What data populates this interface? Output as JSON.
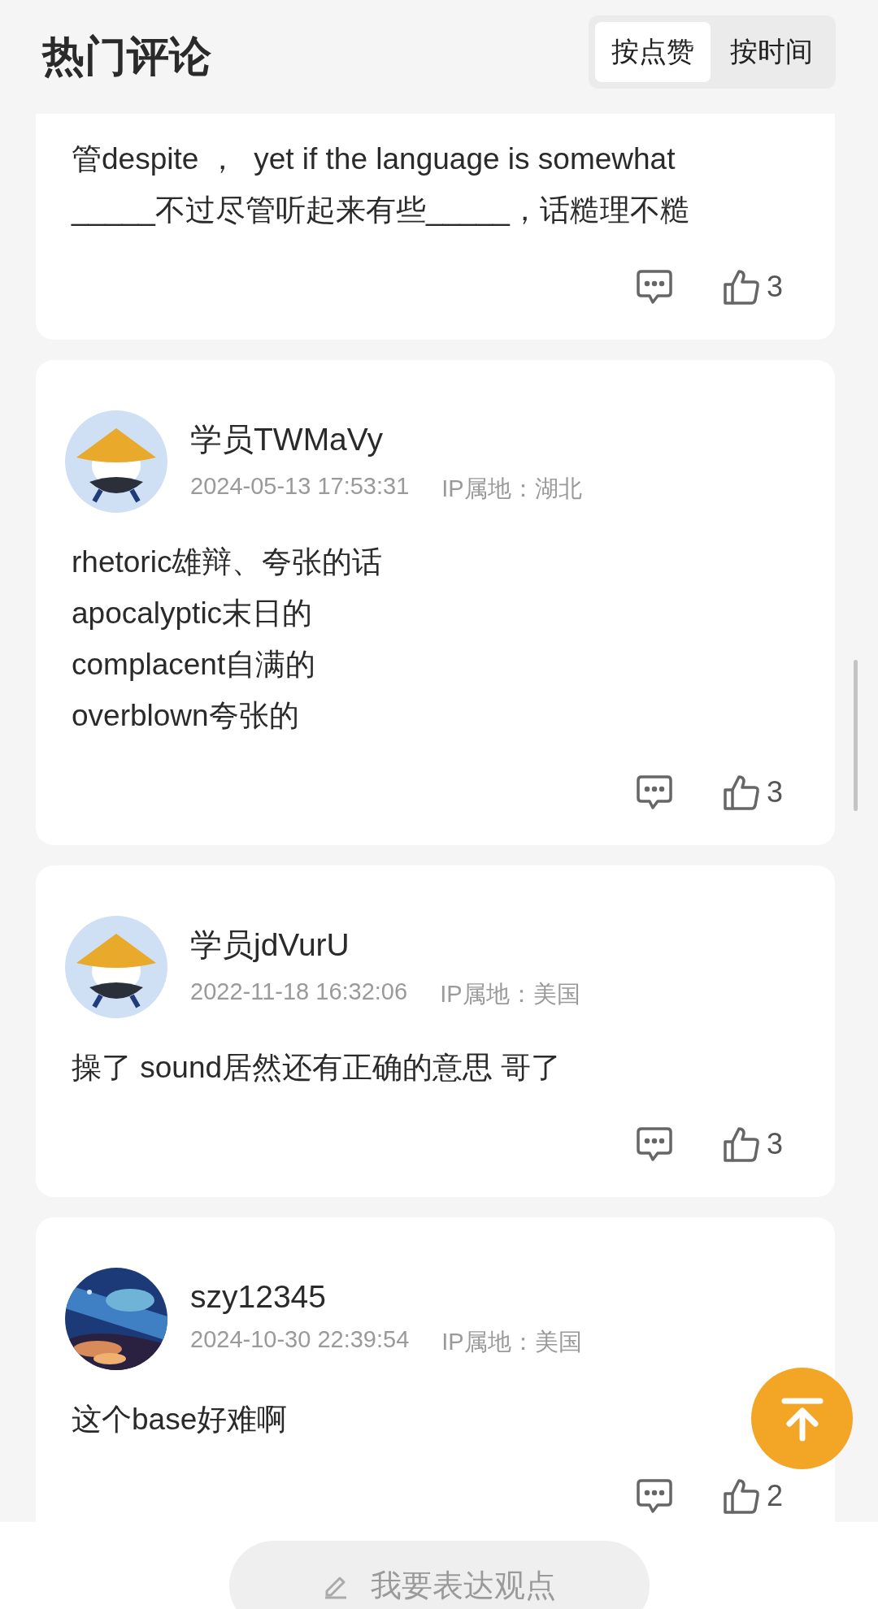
{
  "header": {
    "title": "热门评论",
    "sort_tabs": [
      {
        "label": "按点赞",
        "selected": true
      },
      {
        "label": "按时间",
        "selected": false
      }
    ]
  },
  "comments": [
    {
      "lines": [
        "管despite ，  yet if the language is somewhat",
        "_____不过尽管听起来有些_____，话糙理不糙"
      ],
      "like_count": "3"
    },
    {
      "avatar": {
        "kind": "hat"
      },
      "username": "学员TWMaVy",
      "time": "2024-05-13 17:53:31",
      "ip_location": "IP属地：湖北",
      "lines": [
        "rhetoric雄辩、夸张的话",
        "apocalyptic末日的",
        "complacent自满的",
        "overblown夸张的"
      ],
      "like_count": "3"
    },
    {
      "avatar": {
        "kind": "hat"
      },
      "username": "学员jdVurU",
      "time": "2022-11-18 16:32:06",
      "ip_location": "IP属地：美国",
      "lines": [
        "操了 sound居然还有正确的意思 哥了"
      ],
      "like_count": "3"
    },
    {
      "avatar": {
        "kind": "picture"
      },
      "username": "szy12345",
      "time": "2024-10-30 22:39:54",
      "ip_location": "IP属地：美国",
      "lines": [
        "这个base好难啊"
      ],
      "like_count": "2"
    }
  ],
  "compose_button": {
    "label": "我要表达观点"
  }
}
